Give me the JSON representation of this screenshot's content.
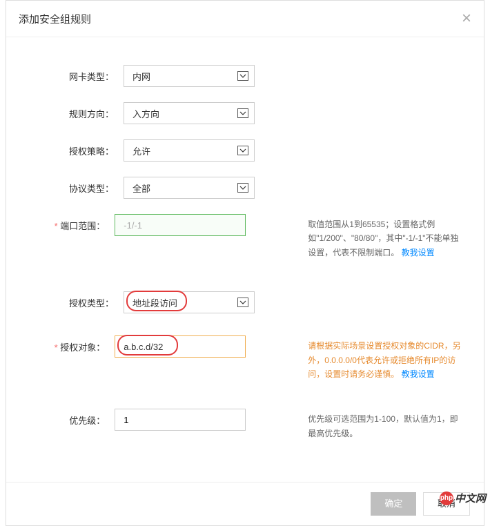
{
  "dialog": {
    "title": "添加安全组规则"
  },
  "form": {
    "nic_type": {
      "label": "网卡类型：",
      "value": "内网"
    },
    "direction": {
      "label": "规则方向：",
      "value": "入方向"
    },
    "auth_policy": {
      "label": "授权策略：",
      "value": "允许"
    },
    "protocol": {
      "label": "协议类型：",
      "value": "全部"
    },
    "port_range": {
      "label": "端口范围：",
      "value": "-1/-1",
      "help": "取值范围从1到65535；设置格式例如\"1/200\"、\"80/80\"，其中\"-1/-1\"不能单独设置，代表不限制端口。",
      "help_link": "教我设置"
    },
    "auth_type": {
      "label": "授权类型：",
      "value": "地址段访问"
    },
    "auth_object": {
      "label": "授权对象：",
      "value": "a.b.c.d/32",
      "help": "请根据实际场景设置授权对象的CIDR，另外，0.0.0.0/0代表允许或拒绝所有IP的访问，设置时请务必谨慎。",
      "help_link": "教我设置"
    },
    "priority": {
      "label": "优先级：",
      "value": "1",
      "help": "优先级可选范围为1-100，默认值为1，即最高优先级。"
    }
  },
  "footer": {
    "confirm": "确定",
    "cancel": "取消"
  },
  "watermark": {
    "logo": "php",
    "text": "中文网"
  }
}
